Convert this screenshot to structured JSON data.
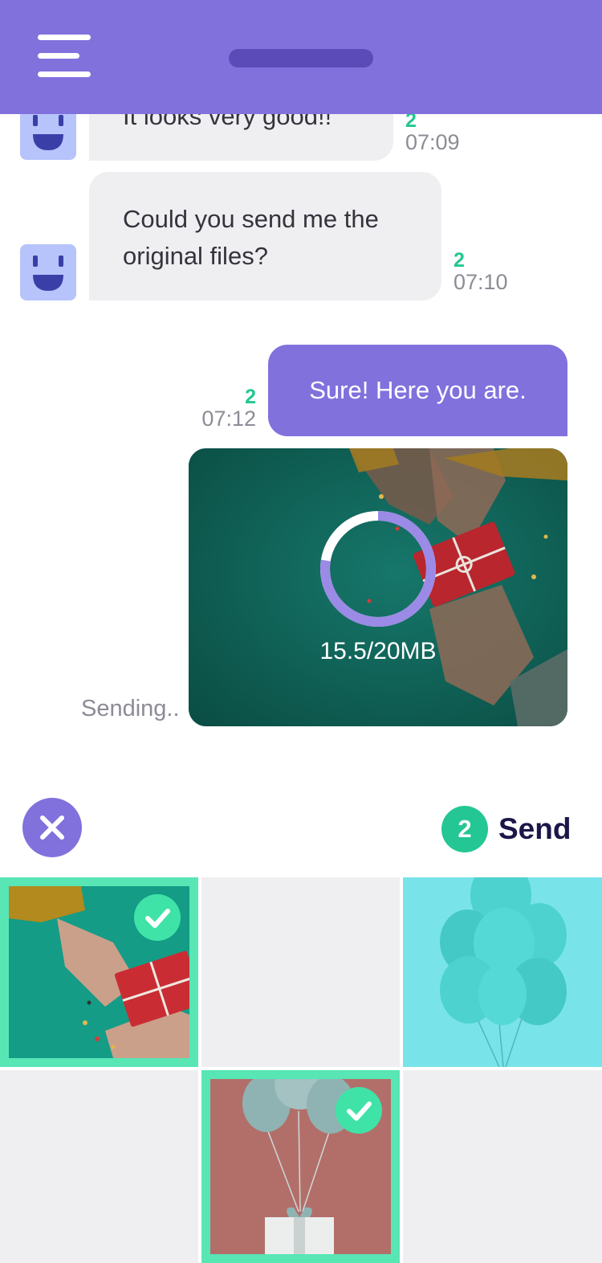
{
  "header": {
    "menu_icon": "hamburger-menu-icon",
    "title_placeholder_shape": "pill"
  },
  "messages": [
    {
      "direction": "incoming",
      "text": "It looks very good!!",
      "count": "2",
      "time": "07:09"
    },
    {
      "direction": "incoming",
      "text": "Could you send me the original files?",
      "count": "2",
      "time": "07:10"
    },
    {
      "direction": "outgoing",
      "text": "Sure! Here you are.",
      "count": "2",
      "time": "07:12"
    }
  ],
  "upload": {
    "progress_label": "15.5/20MB",
    "progress_fraction": 0.775,
    "status": "Sending.."
  },
  "picker": {
    "close_icon": "close-icon",
    "selected_count": "2",
    "send_label": "Send"
  },
  "gallery": [
    {
      "image": "hands-gift-teal",
      "selected": true
    },
    {
      "image": "empty",
      "selected": false
    },
    {
      "image": "balloons-cyan",
      "selected": false
    },
    {
      "image": "empty",
      "selected": false
    },
    {
      "image": "balloons-gift-pink",
      "selected": true
    },
    {
      "image": "empty",
      "selected": false
    }
  ],
  "colors": {
    "primary": "#8071dd",
    "accent_green": "#24c793",
    "selection_green": "#58e6b5",
    "bubble_incoming": "#efeff1",
    "avatar": "#b6c4fb",
    "send_text": "#1b1748"
  }
}
